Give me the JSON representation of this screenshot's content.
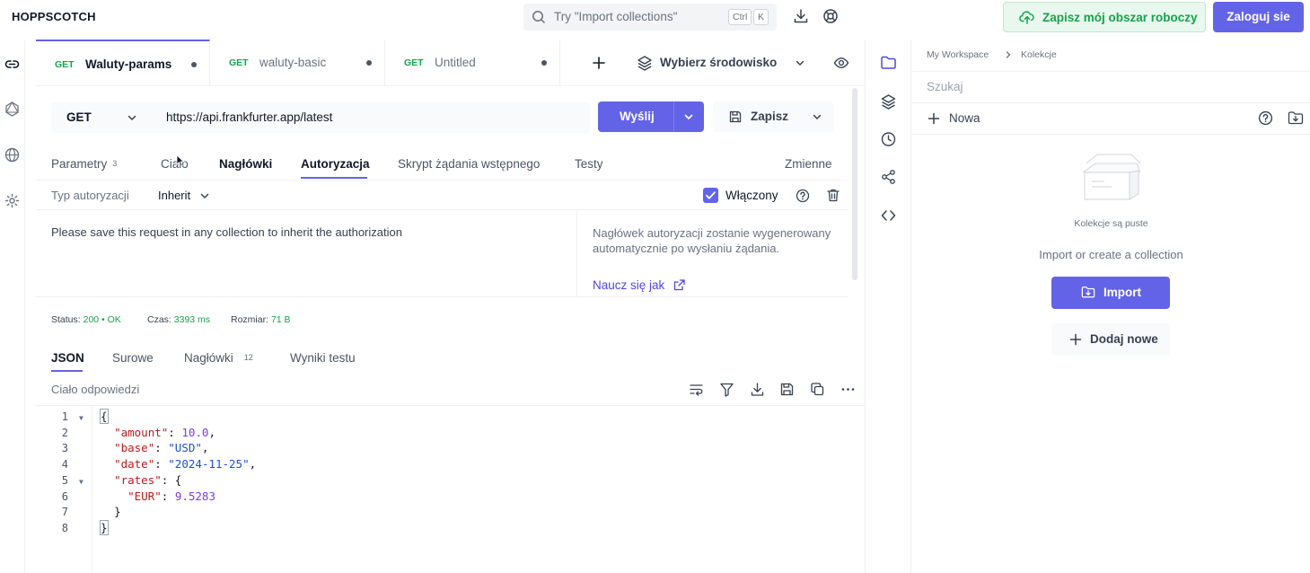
{
  "header": {
    "logo": "HOPPSCOTCH",
    "search_placeholder": "Try \"Import collections\"",
    "kbd_ctrl": "Ctrl",
    "kbd_k": "K",
    "save_workspace": "Zapisz mój obszar roboczy",
    "login": "Zaloguj sie"
  },
  "tabs": [
    {
      "method": "GET",
      "name": "Waluty-params"
    },
    {
      "method": "GET",
      "name": "waluty-basic"
    },
    {
      "method": "GET",
      "name": "Untitled"
    }
  ],
  "environment": {
    "label": "Wybierz środowisko"
  },
  "request": {
    "method": "GET",
    "url": "https://api.frankfurter.app/latest",
    "send": "Wyślij",
    "save": "Zapisz"
  },
  "request_tabs": {
    "params": "Parametry",
    "params_count": "3",
    "body": "Ciało",
    "headers": "Nagłówki",
    "auth": "Autoryzacja",
    "prerequest": "Skrypt żądania wstępnego",
    "tests": "Testy",
    "variables": "Zmienne"
  },
  "auth": {
    "type_label": "Typ autoryzacji",
    "type_value": "Inherit",
    "enabled_label": "Włączony",
    "message": "Please save this request in any collection to inherit the authorization",
    "side_note": "Nagłówek autoryzacji zostanie wygenerowany automatycznie po wysłaniu żądania.",
    "learn_link": "Naucz się jak"
  },
  "status": {
    "status_label": "Status:",
    "status_value": "200  •  OK",
    "time_label": "Czas:",
    "time_value": "3393 ms",
    "size_label": "Rozmiar:",
    "size_value": "71 B"
  },
  "response_tabs": {
    "json": "JSON",
    "raw": "Surowe",
    "headers": "Nagłówki",
    "headers_count": "12",
    "test_results": "Wyniki testu"
  },
  "response": {
    "body_label": "Ciało odpowiedzi",
    "line_numbers": [
      "1",
      "2",
      "3",
      "4",
      "5",
      "6",
      "7",
      "8"
    ],
    "json": {
      "open": "{",
      "amount_key": "\"amount\"",
      "amount_val": "10.0",
      "base_key": "\"base\"",
      "base_val": "\"USD\"",
      "date_key": "\"date\"",
      "date_val": "\"2024-11-25\"",
      "rates_key": "\"rates\"",
      "eur_key": "\"EUR\"",
      "eur_val": "9.5283",
      "inner_close": "}",
      "close": "}"
    }
  },
  "collections": {
    "breadcrumb_workspace": "My Workspace",
    "breadcrumb_current": "Kolekcje",
    "search_placeholder": "Szukaj",
    "new_label": "Nowa",
    "empty_text": "Kolekcje są puste",
    "hint": "Import or create a collection",
    "import_button": "Import",
    "add_new": "Dodaj nowe"
  },
  "colors": {
    "accent": "#6363e8",
    "success": "#16a34a"
  }
}
